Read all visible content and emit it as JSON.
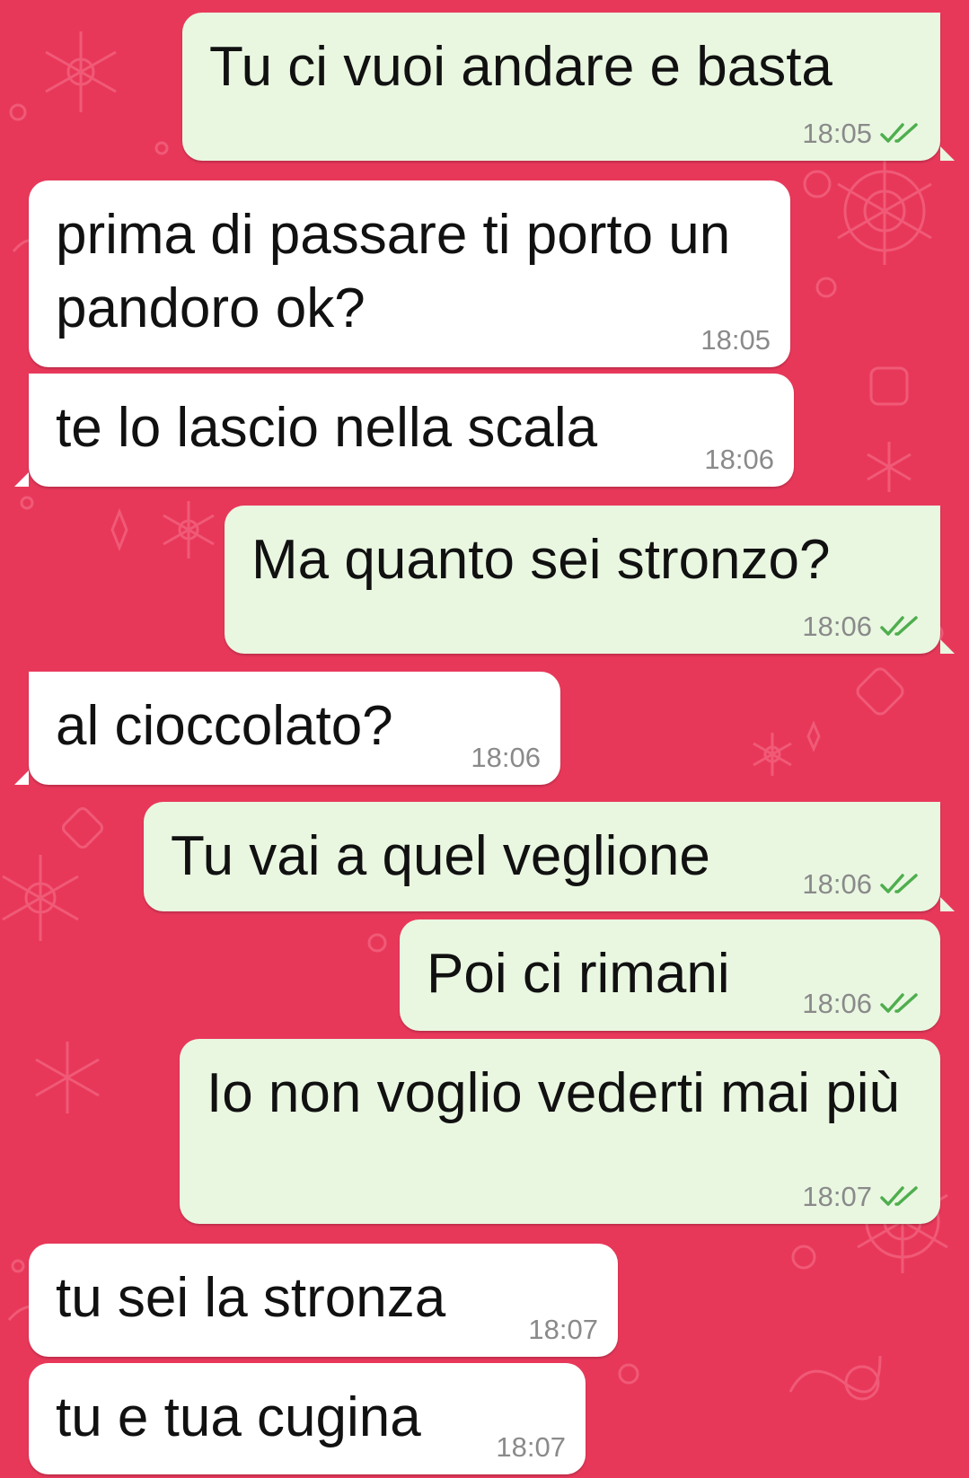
{
  "chat": {
    "messages": [
      {
        "direction": "outgoing",
        "text": "Tu ci vuoi andare e basta",
        "time": "18:05",
        "status": "read-double-check"
      },
      {
        "direction": "incoming",
        "text": "prima di passare ti porto un pandoro ok?",
        "time": "18:05"
      },
      {
        "direction": "incoming",
        "text": "te lo lascio nella scala",
        "time": "18:06"
      },
      {
        "direction": "outgoing",
        "text": "Ma quanto sei stronzo?",
        "time": "18:06",
        "status": "read-double-check"
      },
      {
        "direction": "incoming",
        "text": "al cioccolato?",
        "time": "18:06"
      },
      {
        "direction": "outgoing",
        "text": "Tu vai a quel veglione",
        "time": "18:06",
        "status": "read-double-check"
      },
      {
        "direction": "outgoing",
        "text": "Poi ci rimani",
        "time": "18:06",
        "status": "read-double-check"
      },
      {
        "direction": "outgoing",
        "text": "Io non voglio vederti mai più",
        "time": "18:07",
        "status": "read-double-check"
      },
      {
        "direction": "incoming",
        "text": "tu sei la stronza",
        "time": "18:07"
      },
      {
        "direction": "incoming",
        "text": "tu e tua cugina",
        "time": "18:07"
      }
    ]
  },
  "colors": {
    "background": "#E8385A",
    "incoming_bubble": "#FFFFFF",
    "outgoing_bubble": "#E9F7E1",
    "timestamp": "#8A8A8A",
    "read_ticks": "#4FAE4E"
  },
  "icons": {
    "status": "double-check-icon",
    "wallpaper": "snowflake-pattern"
  }
}
